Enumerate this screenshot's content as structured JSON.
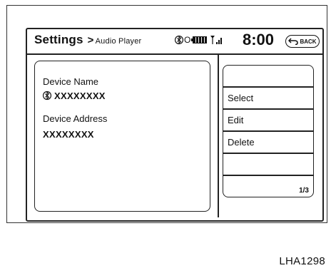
{
  "header": {
    "title": "Settings",
    "separator": ">",
    "breadcrumb": "Audio Player",
    "phone_symbol": "O",
    "clock": "8:00",
    "back_label": "BACK"
  },
  "icons": {
    "bluetooth": "bluetooth-icon",
    "battery": "battery-icon",
    "signal": "signal-antenna-icon",
    "back": "back-arrow-icon"
  },
  "device": {
    "name_label": "Device Name",
    "name_value": "XXXXXXXX",
    "address_label": "Device Address",
    "address_value": "XXXXXXXX"
  },
  "menu": {
    "items": [
      "",
      "Select",
      "Edit",
      "Delete",
      "",
      ""
    ],
    "page_indicator": "1/3"
  },
  "figure_code": "LHA1298"
}
